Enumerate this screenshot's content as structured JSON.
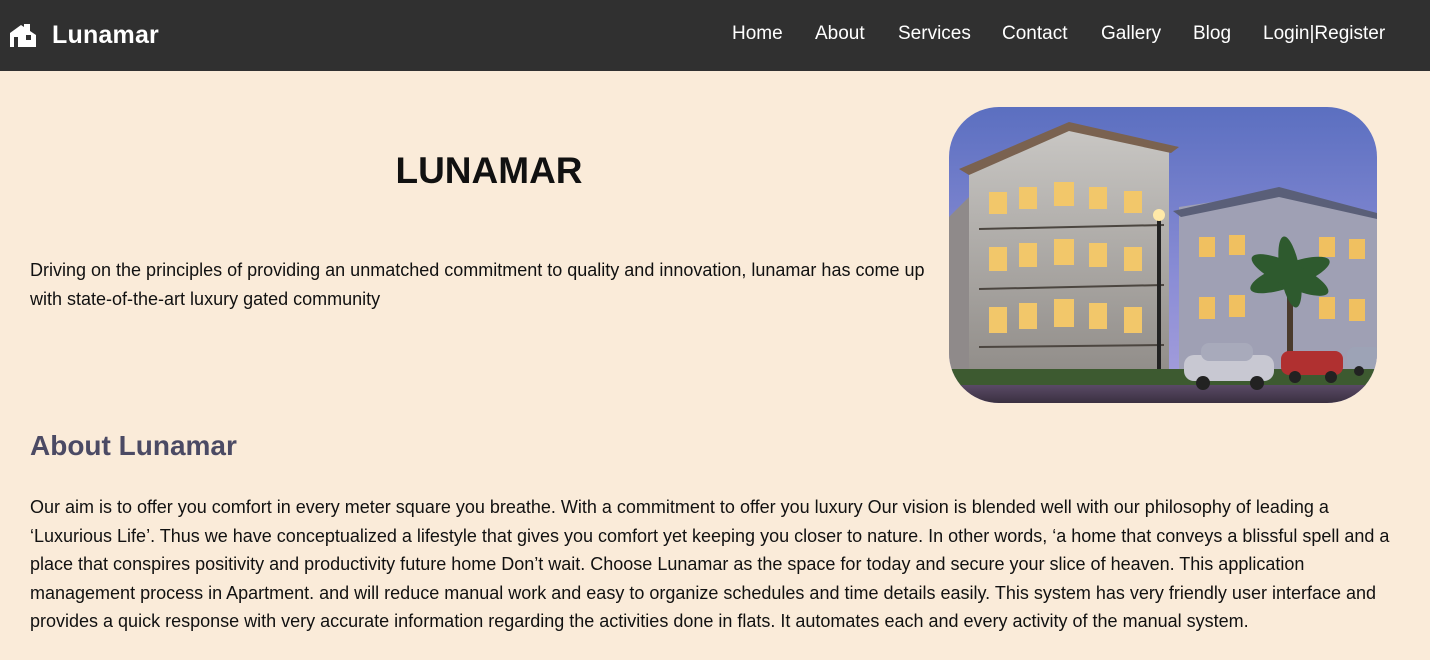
{
  "brand": {
    "name": "Lunamar",
    "icon": "house-icon"
  },
  "nav": {
    "links": [
      {
        "label": "Home"
      },
      {
        "label": "About"
      },
      {
        "label": "Services"
      },
      {
        "label": "Contact"
      },
      {
        "label": "Gallery"
      },
      {
        "label": "Blog"
      },
      {
        "label": "Login|Register"
      }
    ]
  },
  "hero": {
    "title": "LUNAMAR",
    "description": "Driving on the principles of providing an unmatched commitment to quality and innovation, lunamar has come up with state-of-the-art luxury gated community"
  },
  "about": {
    "heading": "About Lunamar",
    "text": "Our aim is to offer you comfort in every meter square you breathe. With a commitment to offer you luxury Our vision is blended well with our philosophy of leading a ‘Luxurious Life’. Thus we have conceptualized a lifestyle that gives you comfort yet keeping you closer to nature. In other words, ‘a home that conveys a blissful spell and a place that conspires positivity and productivity future home Don’t wait. Choose Lunamar as the space for today and secure your slice of heaven. This application management process in Apartment. and will reduce manual work and easy to organize schedules and time details easily. This system has very friendly user interface and provides a quick response with very accurate information regarding the activities done in flats. It automates each and every activity of the manual system."
  },
  "colors": {
    "navbar_bg": "#303030",
    "page_bg": "#faebd9",
    "about_heading": "#4b4a64"
  }
}
